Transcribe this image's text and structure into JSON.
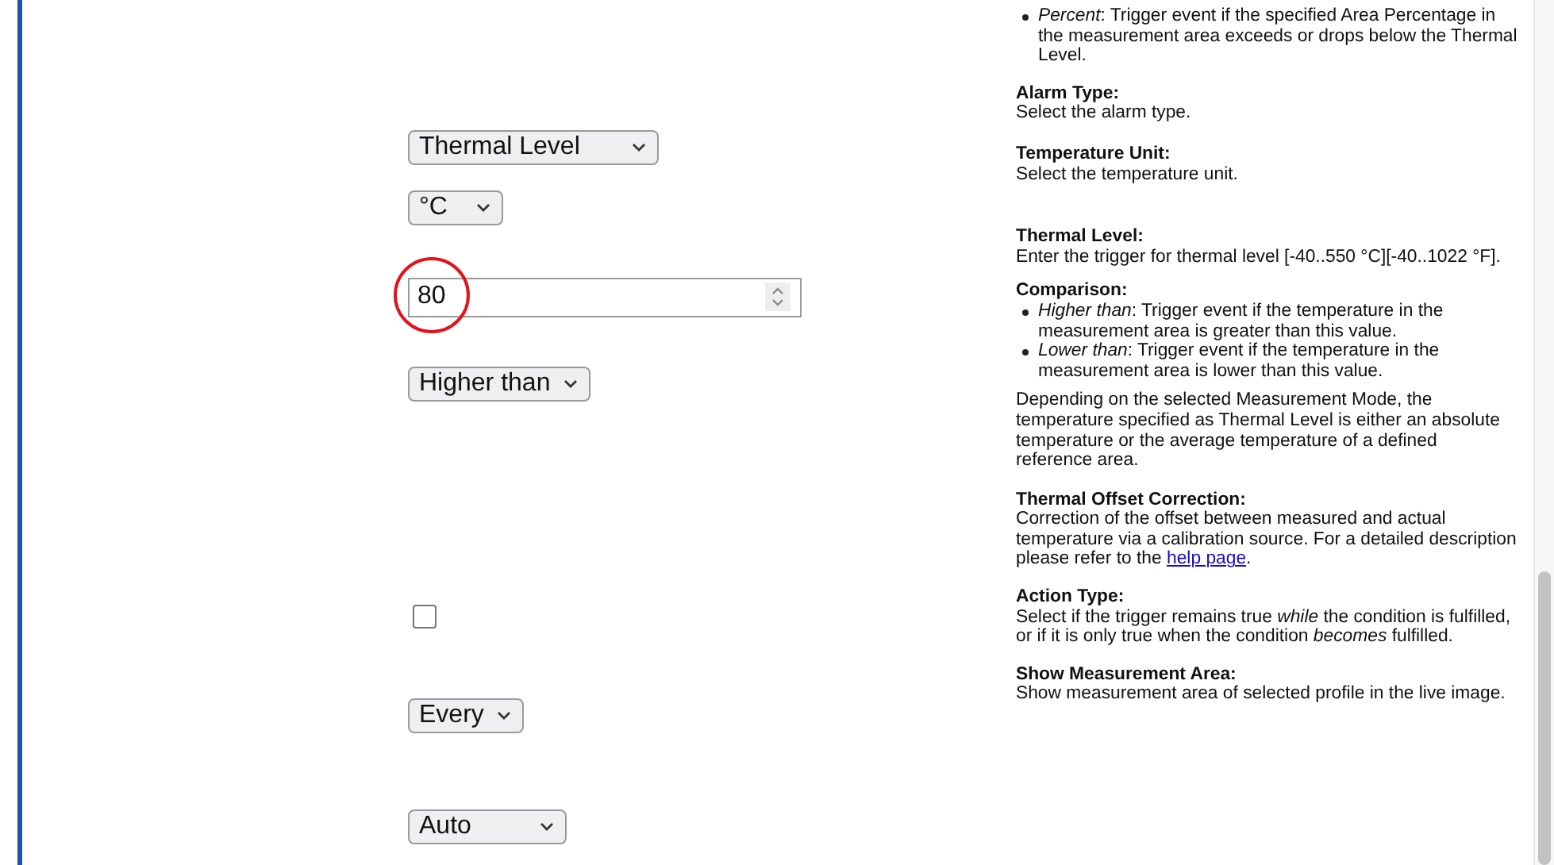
{
  "controls": [
    {
      "kind": "select",
      "value": "Thermal Level"
    },
    {
      "kind": "select",
      "value": "°C"
    },
    {
      "kind": "number",
      "value": "80",
      "highlighted": true
    },
    {
      "kind": "select",
      "value": "Higher than"
    },
    {
      "kind": "checkbox",
      "checked": false
    },
    {
      "kind": "select",
      "value": "Every"
    },
    {
      "kind": "select",
      "value": "Auto"
    }
  ],
  "help": [
    {
      "bullets": [
        "*Percent*: Trigger event if the specified Area Percentage in the measurement area exceeds or drops below the Thermal Level."
      ]
    },
    {
      "heading": "Alarm Type:",
      "body": "Select the alarm type."
    },
    {
      "heading": "Temperature Unit:",
      "body": "Select the temperature unit."
    },
    {
      "heading": "Thermal Level:",
      "body": "Enter the trigger for thermal level [-40..550 °C][-40..1022 °F]."
    },
    {
      "heading": "Comparison:",
      "bullets": [
        "*Higher than*: Trigger event if the temperature in the measurement area is greater than this value.",
        "*Lower than*: Trigger event if the temperature in the measurement area is lower than this value."
      ],
      "body": "Depending on the selected Measurement Mode, the temperature specified as Thermal Level is either an absolute temperature or the average temperature of a defined reference area."
    },
    {
      "heading": "Thermal Offset Correction:",
      "body": "Correction of the offset between measured and actual temperature via a calibration source. For a detailed description please refer to the",
      "link": "help page",
      "body_end": "."
    },
    {
      "heading": "Action Type:",
      "body": "Select if the trigger remains true *while* the condition is fulfilled, or if it is only true when the condition *becomes* fulfilled."
    },
    {
      "heading": "Show Measurement Area:",
      "body": "Show measurement area of selected profile in the live image."
    }
  ]
}
